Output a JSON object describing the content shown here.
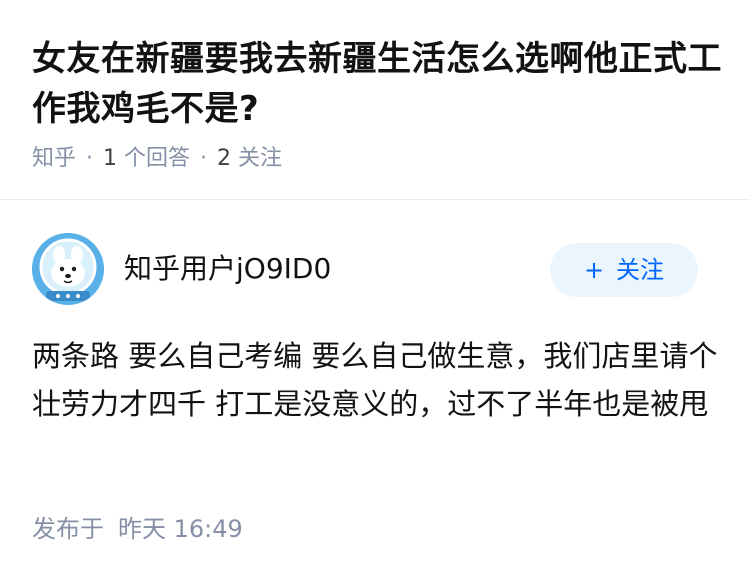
{
  "question": {
    "title": "女友在新疆要我去新疆生活怎么选啊他正式工作我鸡毛不是?",
    "source": "知乎",
    "answer_count": "1",
    "answer_label": "个回答",
    "follower_count": "2",
    "follower_label": "关注"
  },
  "answer": {
    "author": {
      "name": "知乎用户jO9ID0",
      "avatar_icon": "astronaut-dog-avatar"
    },
    "follow_button": {
      "icon": "+",
      "label": "关注"
    },
    "content": "两条路 要么自己考编 要么自己做生意，我们店里请个壮劳力才四千 打工是没意义的，过不了半年也是被甩",
    "published_label": "发布于",
    "published_time": "昨天 16:49"
  },
  "colors": {
    "accent": "#0066ff",
    "follow_bg": "#ebf5fd",
    "meta_text": "#8590a6",
    "title_text": "#121212",
    "avatar_bg": "#5ab0e9"
  }
}
